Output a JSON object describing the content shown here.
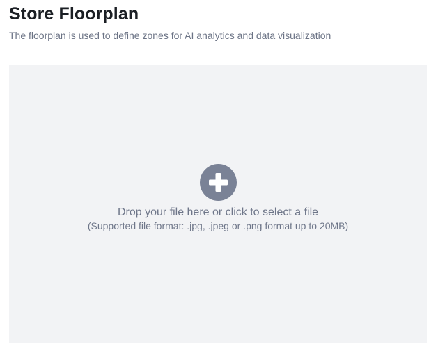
{
  "header": {
    "title": "Store Floorplan",
    "subtitle": "The floorplan is used to define zones for AI analytics and data visualization"
  },
  "upload": {
    "icon": "plus-circle-icon",
    "icon_color": "#7a8296",
    "background_color": "#f2f3f5",
    "primary_text": "Drop your file here or click to select a file",
    "secondary_text": "(Supported file format: .jpg, .jpeg or .png format up to 20MB)"
  }
}
